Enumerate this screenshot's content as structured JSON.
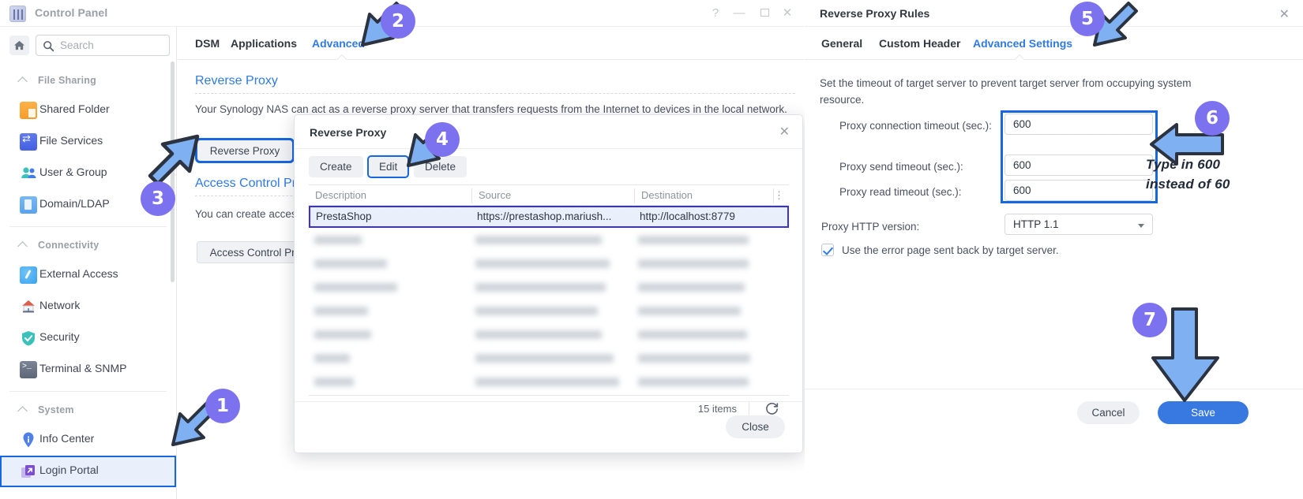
{
  "window": {
    "title": "Control Panel",
    "buttons": {
      "help": "?",
      "minimize": "—",
      "maximize": "",
      "close": "✕"
    }
  },
  "sidebar": {
    "search_placeholder": "Search",
    "groups": [
      {
        "label": "File Sharing",
        "items": [
          {
            "label": "Shared Folder",
            "icon": "shared-folder-icon"
          },
          {
            "label": "File Services",
            "icon": "file-services-icon"
          },
          {
            "label": "User & Group",
            "icon": "user-group-icon"
          },
          {
            "label": "Domain/LDAP",
            "icon": "domain-ldap-icon"
          }
        ]
      },
      {
        "label": "Connectivity",
        "items": [
          {
            "label": "External Access",
            "icon": "external-access-icon"
          },
          {
            "label": "Network",
            "icon": "network-icon"
          },
          {
            "label": "Security",
            "icon": "security-icon"
          },
          {
            "label": "Terminal & SNMP",
            "icon": "terminal-snmp-icon"
          }
        ]
      },
      {
        "label": "System",
        "items": [
          {
            "label": "Info Center",
            "icon": "info-center-icon"
          },
          {
            "label": "Login Portal",
            "icon": "login-portal-icon",
            "selected": true
          }
        ]
      }
    ]
  },
  "main": {
    "tabs": [
      {
        "label": "DSM",
        "active": false
      },
      {
        "label": "Applications",
        "active": false
      },
      {
        "label": "Advanced",
        "active": true
      }
    ],
    "reverse_proxy": {
      "title": "Reverse Proxy",
      "description": "Your Synology NAS can act as a reverse proxy server that transfers requests from the Internet to devices in the local network.",
      "button": "Reverse Proxy"
    },
    "access_control": {
      "title": "Access Control Profile",
      "description": "You can create access control profiles",
      "button": "Access Control Profile"
    }
  },
  "modal": {
    "title": "Reverse Proxy",
    "close_icon": "✕",
    "toolbar": [
      {
        "label": "Create",
        "highlighted": false
      },
      {
        "label": "Edit",
        "highlighted": true
      },
      {
        "label": "Delete",
        "highlighted": false
      }
    ],
    "columns": [
      "Description",
      "Source",
      "Destination"
    ],
    "selected_row": {
      "description": "PrestaShop",
      "source": "https://prestashop.mariush...",
      "destination": "http://localhost:8779"
    },
    "blurred_row_count": 7,
    "items_count": "15 items",
    "refresh_icon": "refresh-icon",
    "footer_button": "Close"
  },
  "rules_panel": {
    "title": "Reverse Proxy Rules",
    "close_icon": "✕",
    "tabs": [
      {
        "label": "General",
        "active": false
      },
      {
        "label": "Custom Header",
        "active": false
      },
      {
        "label": "Advanced Settings",
        "active": true
      }
    ],
    "description": "Set the timeout of target server to prevent target server from occupying system resource.",
    "fields": [
      {
        "label": "Proxy connection timeout (sec.):",
        "value": "600"
      },
      {
        "label": "Proxy send timeout (sec.):",
        "value": "600"
      },
      {
        "label": "Proxy read timeout (sec.):",
        "value": "600"
      }
    ],
    "http_version": {
      "label": "Proxy HTTP version:",
      "value": "HTTP 1.1"
    },
    "error_page": {
      "label": "Use the error page sent back by target server.",
      "checked": true
    },
    "footer": {
      "cancel": "Cancel",
      "save": "Save"
    }
  },
  "annotations": {
    "note": "Type in 600 instead of 60",
    "badges": [
      "1",
      "2",
      "3",
      "4",
      "5",
      "6",
      "7"
    ],
    "badge_color": "#7c72ef",
    "arrow_fill": "#7fb0f2",
    "arrow_stroke": "#2b3340"
  }
}
